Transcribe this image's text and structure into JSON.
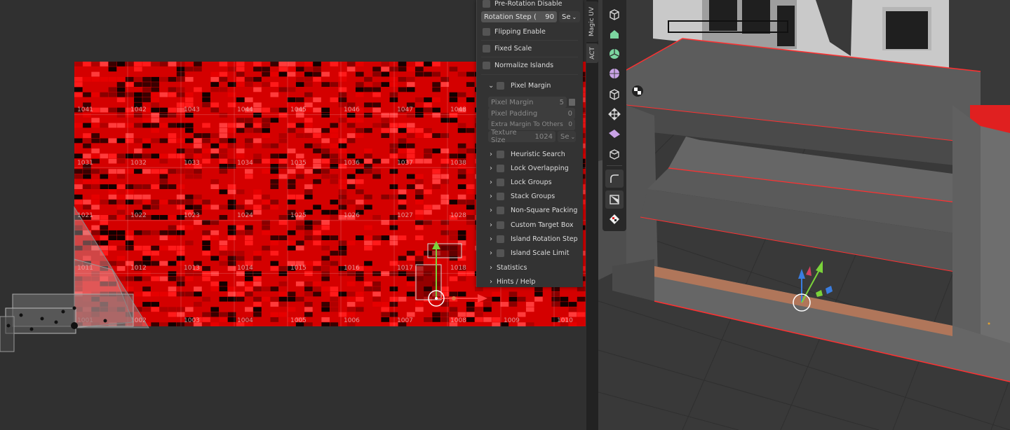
{
  "uv_editor": {
    "tile_labels": [
      "1041",
      "1042",
      "1043",
      "1044",
      "1045",
      "1046",
      "1047",
      "1048",
      "1031",
      "1032",
      "1033",
      "1034",
      "1035",
      "1036",
      "1037",
      "1038",
      "1021",
      "1022",
      "1023",
      "1024",
      "1025",
      "1026",
      "1027",
      "1028",
      "1011",
      "1012",
      "1013",
      "1014",
      "1015",
      "1016",
      "1017",
      "1018",
      "1001",
      "1002",
      "1003",
      "1004",
      "1005",
      "1006",
      "1007",
      "1008",
      "1009",
      "1010"
    ]
  },
  "n_panel": {
    "pre_rotation_disable": "Pre-Rotation Disable",
    "rotation_step_label": "Rotation Step (",
    "rotation_step_value": "90",
    "rotation_step_dropdown": "Se",
    "flipping_enable": "Flipping Enable",
    "fixed_scale": "Fixed Scale",
    "normalize_islands": "Normalize Islands",
    "pixel_margin_header": "Pixel Margin",
    "pixel_margin_label": "Pixel Margin",
    "pixel_margin_value": "5",
    "pixel_padding_label": "Pixel Padding",
    "pixel_padding_value": "0",
    "extra_margin_label": "Extra Margin To Others",
    "extra_margin_value": "0",
    "texture_size_label": "Texture Size",
    "texture_size_value": "1024",
    "texture_size_dropdown": "Se",
    "sections": [
      "Heuristic Search",
      "Lock Overlapping",
      "Lock Groups",
      "Stack Groups",
      "Non-Square Packing",
      "Custom Target Box",
      "Island Rotation Step",
      "Island Scale Limit"
    ],
    "statistics": "Statistics",
    "hints_help": "Hints / Help"
  },
  "side_tabs": [
    "Magic UV",
    "ACT"
  ],
  "toolbar_tools": [
    "cursor-cube-icon",
    "select-box-icon",
    "sphere-icon",
    "pie-icon",
    "uv-sphere-icon",
    "cube-outline-icon",
    "move-icon",
    "prism-icon",
    "extrude-cube-icon",
    "bevel-icon",
    "edge-slide-icon",
    "checker-icon"
  ],
  "colors": {
    "uv_red": "#d40000",
    "selection_red": "#ff3030",
    "accent_orange": "#e07040"
  }
}
